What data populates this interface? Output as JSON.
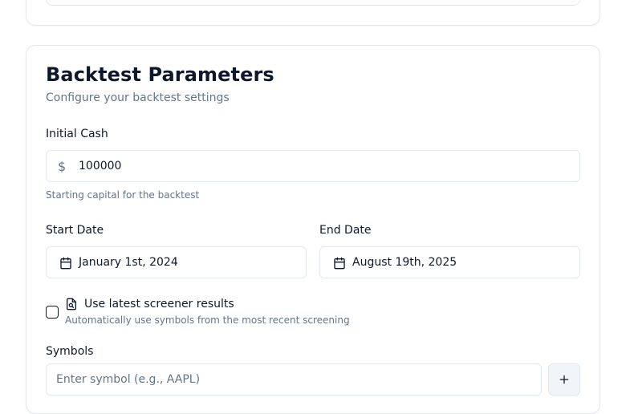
{
  "parameters": {
    "title": "Backtest Parameters",
    "subtitle": "Configure your backtest settings",
    "initial_cash": {
      "label": "Initial Cash",
      "currency_symbol": "$",
      "value": "100000",
      "help": "Starting capital for the backtest"
    },
    "start_date": {
      "label": "Start Date",
      "value": "January 1st, 2024",
      "icon": "calendar-icon"
    },
    "end_date": {
      "label": "End Date",
      "value": "August 19th, 2025",
      "icon": "calendar-icon"
    },
    "use_screener": {
      "label": "Use latest screener results",
      "help": "Automatically use symbols from the most recent screening",
      "checked": false,
      "icon": "file-search-icon"
    },
    "symbols": {
      "label": "Symbols",
      "placeholder": "Enter symbol (e.g., AAPL)",
      "value": "",
      "add_icon": "plus-icon"
    }
  },
  "colors": {
    "text": "#0f172a",
    "muted": "#64748b",
    "border": "#e2e8f0",
    "button_bg": "#f1f5f9"
  }
}
